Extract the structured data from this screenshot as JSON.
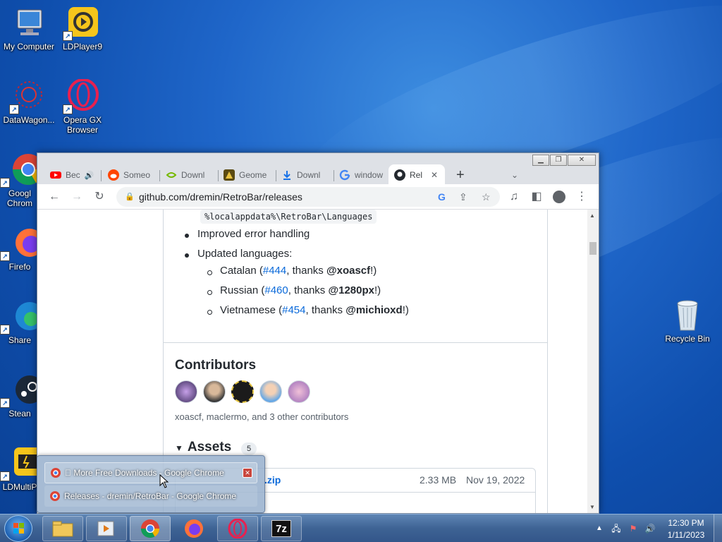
{
  "desktop": {
    "icons": [
      {
        "label": "My Computer"
      },
      {
        "label": "LDPlayer9"
      },
      {
        "label": "DataWagon..."
      },
      {
        "label": "Opera GX Browser"
      },
      {
        "label": "Googl Chrom"
      },
      {
        "label": "Firefo"
      },
      {
        "label": "Share"
      },
      {
        "label": "Stean"
      },
      {
        "label": "LDMultiP"
      },
      {
        "label": "Recycle Bin"
      }
    ]
  },
  "browser": {
    "tabs": [
      {
        "label": "Bec",
        "icon": "youtube-icon"
      },
      {
        "label": "Someo",
        "icon": "reddit-icon"
      },
      {
        "label": "Downl",
        "icon": "nvidia-icon"
      },
      {
        "label": "Geome",
        "icon": "game-icon"
      },
      {
        "label": "Downl",
        "icon": "download-icon"
      },
      {
        "label": "window",
        "icon": "google-icon"
      },
      {
        "label": "Rel",
        "icon": "github-icon"
      }
    ],
    "new_tab": "+",
    "url": "github.com/dremin/RetroBar/releases",
    "page": {
      "code_path": "%localappdata%\\RetroBar\\Languages",
      "bullets": [
        "Improved error handling",
        "Updated languages:"
      ],
      "languages": [
        {
          "name": "Catalan",
          "issue": "#444",
          "thanks": "thanks",
          "user": "@xoascf"
        },
        {
          "name": "Russian",
          "issue": "#460",
          "thanks": "thanks",
          "user": "@1280px"
        },
        {
          "name": "Vietnamese",
          "issue": "#454",
          "thanks": "thanks",
          "user": "@michioxd"
        }
      ],
      "contributors_heading": "Contributors",
      "contributors_text": "xoascf, maclermo, and 3 other contributors",
      "assets_heading": "Assets",
      "assets_count": "5",
      "asset_row": {
        "name": ".zip",
        "size": "2.33 MB",
        "date": "Nov 19, 2022"
      }
    }
  },
  "taskbar_popup": {
    "items": [
      {
        "label": "\u0000 More Free Downloads - Google Chrome"
      },
      {
        "label": "Releases - dremin/RetroBar - Google Chrome"
      }
    ]
  },
  "taskbar": {
    "clock_time": "12:30 PM",
    "clock_date": "1/11/2023",
    "apps": [
      "explorer",
      "media-player",
      "chrome",
      "firefox",
      "opera",
      "7zip"
    ],
    "sevenzip_label": "7z"
  }
}
